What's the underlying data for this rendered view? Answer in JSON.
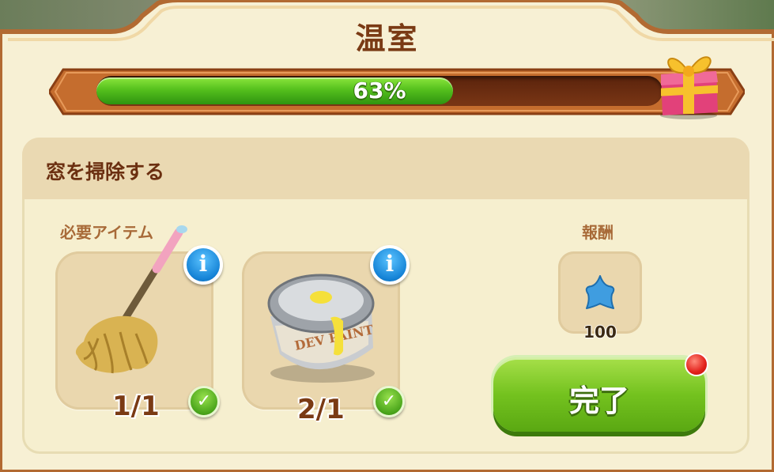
{
  "header": {
    "title": "温室",
    "progress_percent": 63,
    "progress_label": "63%"
  },
  "task": {
    "title": "窓を掃除する",
    "required_items_label": "必要アイテム",
    "items": [
      {
        "name": "mop",
        "count_label": "1/1",
        "completed": true,
        "info_icon": "i"
      },
      {
        "name": "paint-can",
        "count_label": "2/1",
        "completed": true,
        "info_icon": "i"
      }
    ]
  },
  "reward": {
    "label": "報酬",
    "icon": "blue-star-icon",
    "amount": "100"
  },
  "actions": {
    "complete_label": "完了"
  },
  "colors": {
    "title_brown": "#7a3a14",
    "progress_green": "#55c01d",
    "button_green": "#74c21f",
    "info_blue": "#1583d6",
    "badge_red": "#e3201b"
  }
}
